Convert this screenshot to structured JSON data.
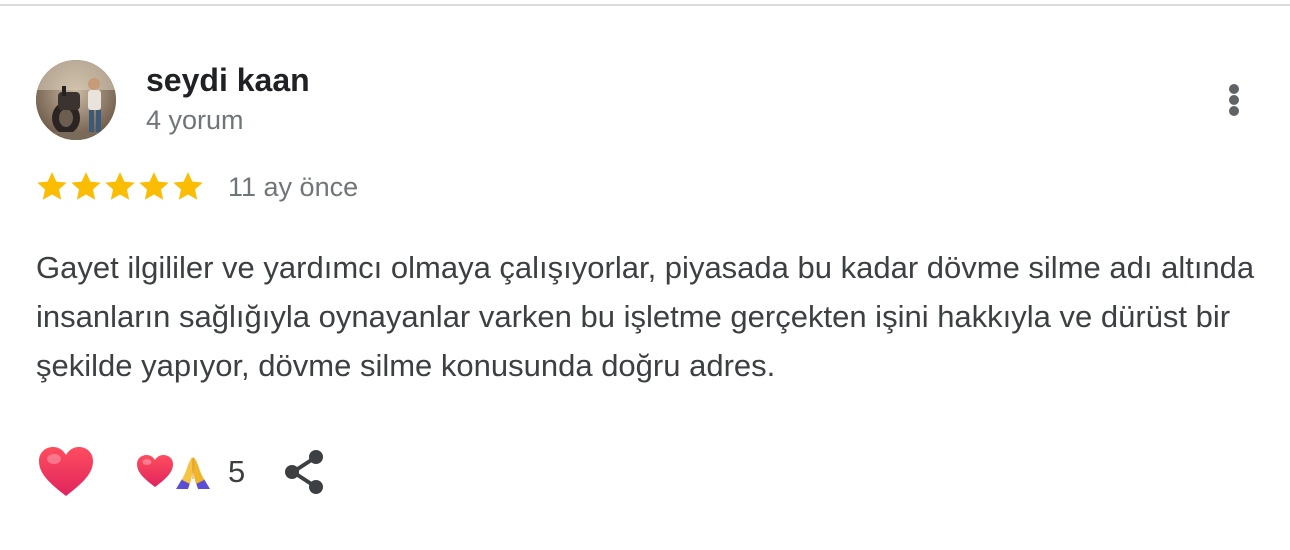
{
  "review": {
    "author_name": "seydi kaan",
    "review_count": "4 yorum",
    "rating": 5,
    "rating_max": 5,
    "time_ago": "11 ay önce",
    "text": "Gayet ilgililer ve yardımcı olmaya çalışıyorlar, piyasada bu kadar dövme silme adı altında insanların sağlığıyla oynayanlar varken bu işletme gerçekten işini hakkıyla ve dürüst bir şekilde yapıyor, dövme silme konusunda doğru adres."
  },
  "reactions": {
    "icons": [
      "heart-icon",
      "folded-hands-icon"
    ],
    "count": "5"
  },
  "icons": {
    "more": "more-vert-icon",
    "like": "heart-icon",
    "share": "share-icon",
    "star": "star-icon"
  },
  "colors": {
    "star": "#fbbc04",
    "heart": "#f0364a",
    "secondary_text": "#70757a",
    "primary_text": "#202124",
    "body_text": "#3c4043",
    "icon_gray": "#5f6368"
  }
}
